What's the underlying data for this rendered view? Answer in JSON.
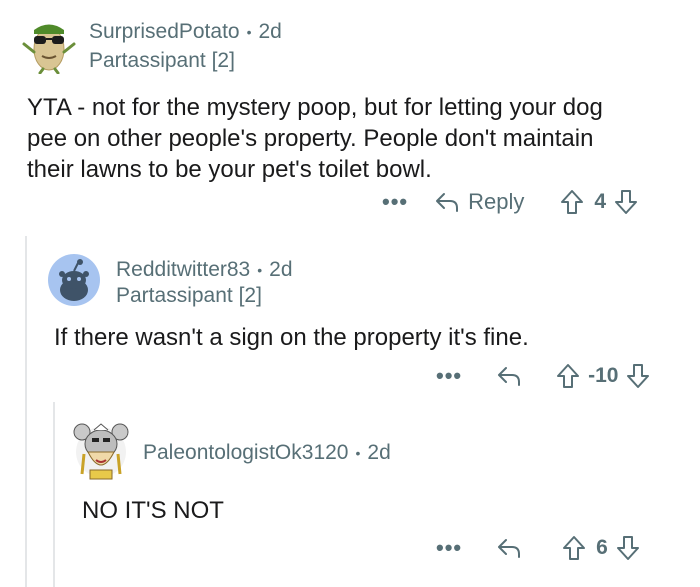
{
  "comments": [
    {
      "username": "SurprisedPotato",
      "time": "2d",
      "flair": "Partassipant [2]",
      "body_lines": [
        "YTA - not for the mystery poop, but for letting your dog",
        "pee on other people's property. People don't maintain",
        "their lawns to be your pet's toilet bowl."
      ],
      "reply_label": "Reply",
      "score": "4",
      "avatar_icon": "potato-sunglasses-avatar"
    },
    {
      "username": "Redditwitter83",
      "time": "2d",
      "flair": "Partassipant [2]",
      "body_lines": [
        "If there wasn't a sign on the property it's fine."
      ],
      "score": "-10",
      "avatar_icon": "snoo-default-avatar",
      "accent": "#a7c4f0"
    },
    {
      "username": "PaleontologistOk3120",
      "time": "2d",
      "body_lines": [
        "NO IT'S NOT"
      ],
      "score": "6",
      "avatar_icon": "cartoon-character-avatar"
    }
  ],
  "separator": "•",
  "more_label": "•••"
}
